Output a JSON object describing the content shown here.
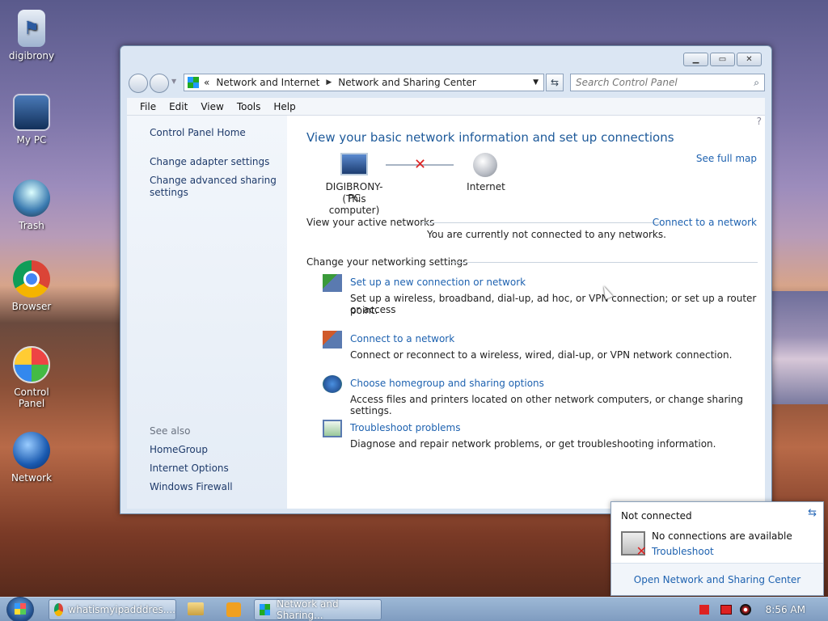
{
  "desktop": {
    "icons": [
      {
        "label": "digibrony"
      },
      {
        "label": "My PC"
      },
      {
        "label": "Trash"
      },
      {
        "label": "Browser"
      },
      {
        "label": "Control Panel"
      },
      {
        "label": "Network"
      }
    ]
  },
  "window": {
    "address": {
      "root": "«",
      "part1": "Network and Internet",
      "part2": "Network and Sharing Center"
    },
    "search_placeholder": "Search Control Panel",
    "menu": [
      "File",
      "Edit",
      "View",
      "Tools",
      "Help"
    ],
    "sidebar": {
      "home": "Control Panel Home",
      "adapter": "Change adapter settings",
      "advanced_line1": "Change advanced sharing",
      "advanced_line2": "settings",
      "see_also": "See also",
      "homegroup": "HomeGroup",
      "internet_options": "Internet Options",
      "firewall": "Windows Firewall"
    },
    "main": {
      "heading": "View your basic network information and set up connections",
      "see_full_map": "See full map",
      "computer_name": "DIGIBRONY-PC",
      "computer_sub": "(This computer)",
      "internet": "Internet",
      "active_networks": "View your active networks",
      "connect_to_network": "Connect to a network",
      "not_connected": "You are currently not connected to any networks.",
      "change_settings": "Change your networking settings",
      "tasks": [
        {
          "title": "Set up a new connection or network",
          "desc1": "Set up a wireless, broadband, dial-up, ad hoc, or VPN connection; or set up a router or access",
          "desc2": "point."
        },
        {
          "title": "Connect to a network",
          "desc1": "Connect or reconnect to a wireless, wired, dial-up, or VPN network connection."
        },
        {
          "title": "Choose homegroup and sharing options",
          "desc1": "Access files and printers located on other network computers, or change sharing settings."
        },
        {
          "title": "Troubleshoot problems",
          "desc1": "Diagnose and repair network problems, or get troubleshooting information."
        }
      ]
    }
  },
  "popup": {
    "title": "Not connected",
    "message": "No connections are available",
    "troubleshoot": "Troubleshoot",
    "open_center": "Open Network and Sharing Center"
  },
  "taskbar": {
    "items": [
      "whatismyipadddres....",
      "Network and Sharing..."
    ],
    "clock": "8:56 AM"
  }
}
